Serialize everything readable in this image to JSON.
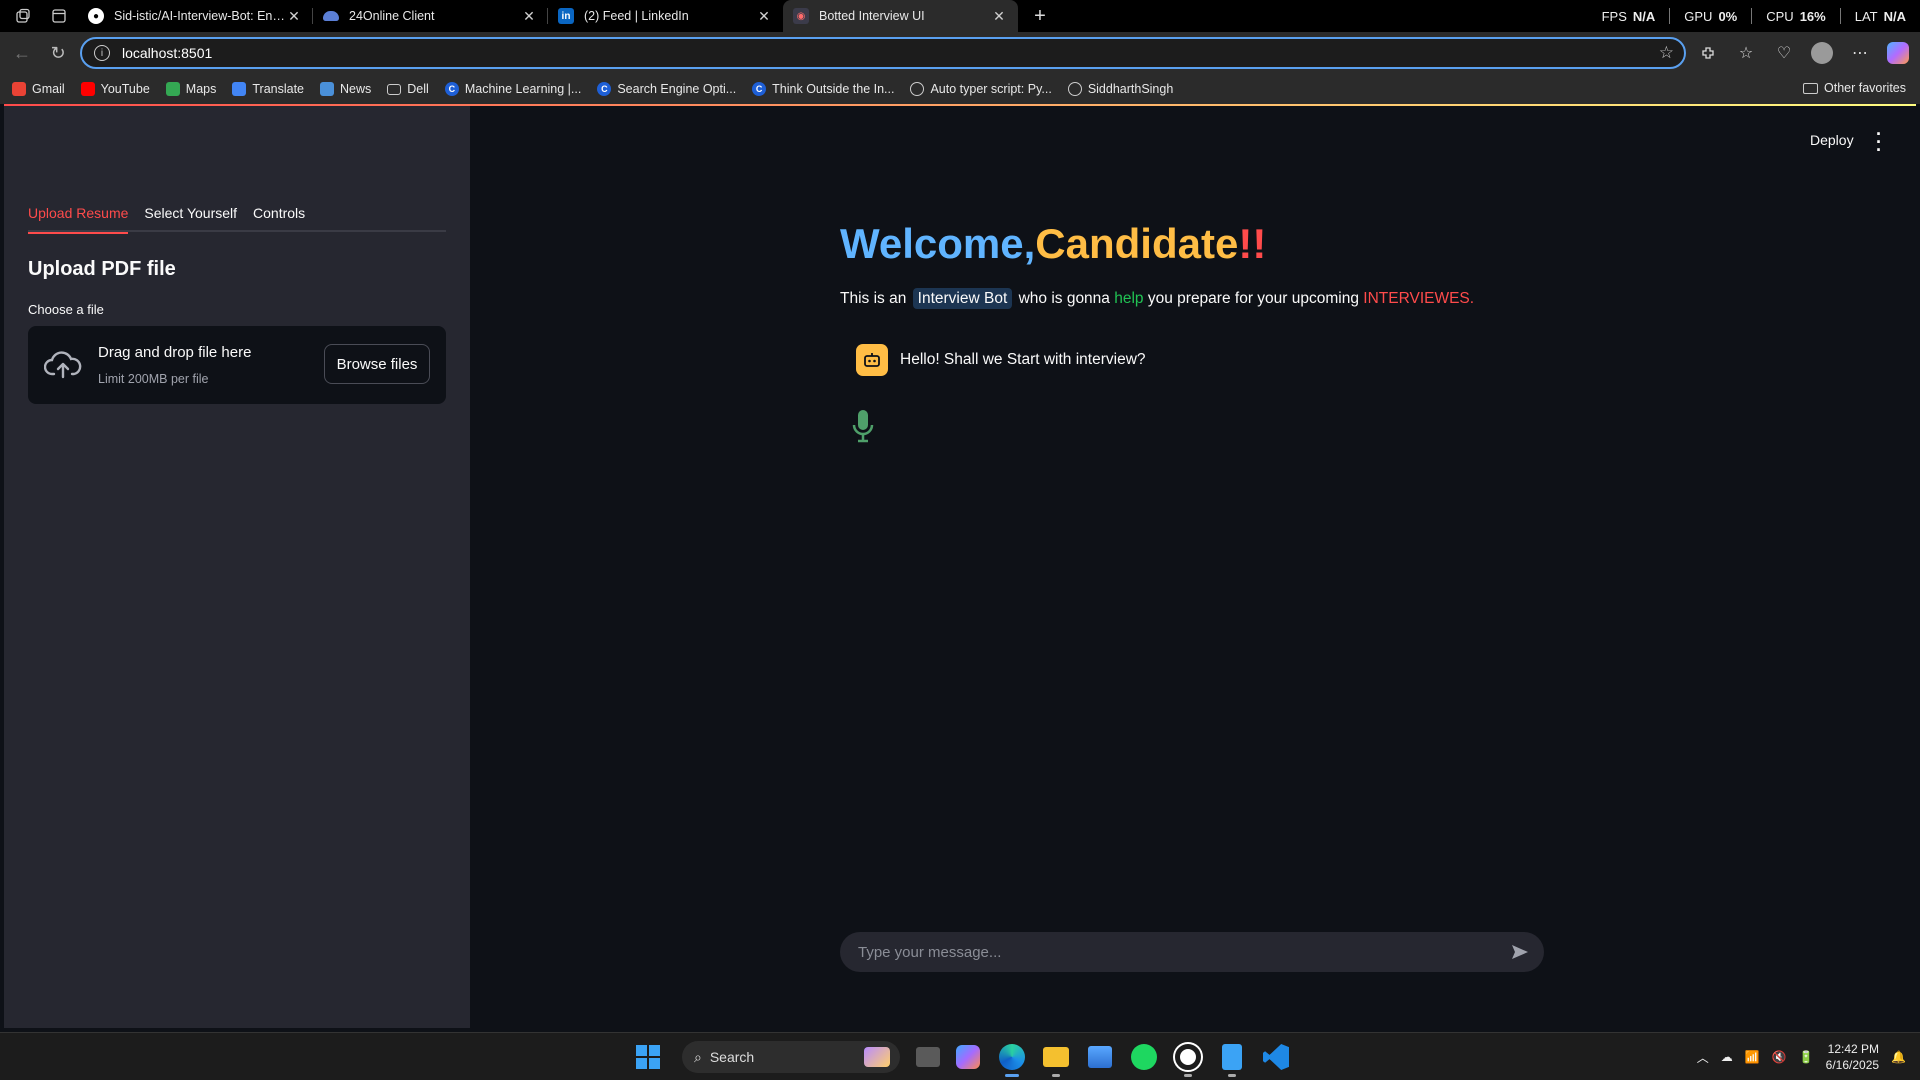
{
  "browser": {
    "tabs": [
      {
        "title": "Sid-istic/AI-Interview-Bot: Engine",
        "favicon": "github-icon",
        "active": false
      },
      {
        "title": "24Online Client",
        "favicon": "cloud-icon",
        "active": false
      },
      {
        "title": "(2) Feed | LinkedIn",
        "favicon": "linkedin-icon",
        "active": false
      },
      {
        "title": "Botted Interview UI",
        "favicon": "streamlit-icon",
        "active": true
      }
    ],
    "perf": {
      "fps_label": "FPS",
      "fps_value": "N/A",
      "gpu_label": "GPU",
      "gpu_value": "0%",
      "cpu_label": "CPU",
      "cpu_value": "16%",
      "lat_label": "LAT",
      "lat_value": "N/A"
    },
    "url": "localhost:8501",
    "bookmarks": [
      {
        "label": "Gmail",
        "icon": "gmail-icon",
        "color": "#ea4335"
      },
      {
        "label": "YouTube",
        "icon": "youtube-icon",
        "color": "#ff0000"
      },
      {
        "label": "Maps",
        "icon": "maps-icon",
        "color": "#34a853"
      },
      {
        "label": "Translate",
        "icon": "translate-icon",
        "color": "#4285f4"
      },
      {
        "label": "News",
        "icon": "news-icon",
        "color": "#4a90d9"
      },
      {
        "label": "Dell",
        "icon": "folder-icon",
        "color": "#888888"
      },
      {
        "label": "Machine Learning |...",
        "icon": "c-icon",
        "color": "#1e5fd6"
      },
      {
        "label": "Search Engine Opti...",
        "icon": "c-icon",
        "color": "#1e5fd6"
      },
      {
        "label": "Think Outside the In...",
        "icon": "c-icon",
        "color": "#1e5fd6"
      },
      {
        "label": "Auto typer script: Py...",
        "icon": "gear-icon",
        "color": "#777777"
      },
      {
        "label": "SiddharthSingh",
        "icon": "globe-icon",
        "color": "#777777"
      }
    ],
    "other_favorites": "Other favorites"
  },
  "sidebar": {
    "tabs": [
      {
        "label": "Upload Resume",
        "active": true
      },
      {
        "label": "Select Yourself",
        "active": false
      },
      {
        "label": "Controls",
        "active": false
      }
    ],
    "heading": "Upload PDF file",
    "file_label": "Choose a file",
    "dropzone_title": "Drag and drop file here",
    "dropzone_limit": "Limit 200MB per file",
    "browse_label": "Browse files"
  },
  "header": {
    "deploy_label": "Deploy"
  },
  "main": {
    "title_welcome": "Welcome,",
    "title_candidate": "Candidate",
    "title_exclaim": "!!",
    "intro_before": "This is an",
    "intro_highlight": "Interview Bot",
    "intro_mid": "who is gonna",
    "intro_help": "help",
    "intro_after": "you prepare for your upcoming",
    "intro_interviews": "INTERVIEWES.",
    "bot_message": "Hello! Shall we Start with interview?",
    "chat_placeholder": "Type your message..."
  },
  "taskbar": {
    "search_label": "Search",
    "time": "12:42 PM",
    "date": "6/16/2025"
  },
  "colors": {
    "accent": "#ff4b4b",
    "welcome": "#60b4ff",
    "candidate": "#ffbd45",
    "help": "#21c354",
    "sidebar_bg": "#262730",
    "main_bg": "#0e1117"
  }
}
